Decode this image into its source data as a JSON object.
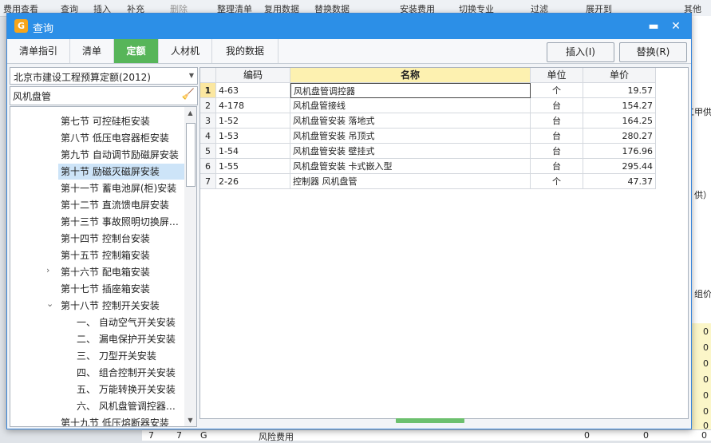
{
  "background": {
    "toolbar": [
      "费用查看",
      "查询",
      "插入",
      "补充",
      "删除",
      "整理清单",
      "复用数据",
      "替换数据",
      "安装费用",
      "切换专业",
      "过滤",
      "展开到",
      "其他"
    ],
    "right_labels": [
      "工甲供",
      "供）",
      "组价"
    ],
    "right_zeros": [
      "0",
      "0",
      "0",
      "0",
      "0",
      "0",
      "0"
    ],
    "bottom_row": {
      "a": "7",
      "b": "7",
      "c": "G",
      "name": "风险费用",
      "v1": "0",
      "v2": "0",
      "v3": "0"
    }
  },
  "dialog": {
    "title": "查询",
    "minimize_icon": "minimize-icon",
    "close_icon": "close-icon",
    "tabs": [
      "清单指引",
      "清单",
      "定额",
      "人材机",
      "我的数据"
    ],
    "active_tab": "定额",
    "insert_label": "插入(I)",
    "replace_label": "替换(R)"
  },
  "left": {
    "quota_library": "北京市建设工程预算定额(2012)",
    "search_value": "风机盘管",
    "tree": [
      {
        "label": "第七节 可控硅柜安装",
        "indent": 1,
        "arrow": ""
      },
      {
        "label": "第八节 低压电容器柜安装",
        "indent": 1,
        "arrow": ""
      },
      {
        "label": "第九节 自动调节励磁屏安装",
        "indent": 1,
        "arrow": ""
      },
      {
        "label": "第十节 励磁灭磁屏安装",
        "indent": 1,
        "arrow": "",
        "selected": true
      },
      {
        "label": "第十一节 蓄电池屏(柜)安装",
        "indent": 1,
        "arrow": ""
      },
      {
        "label": "第十二节 直流馈电屏安装",
        "indent": 1,
        "arrow": ""
      },
      {
        "label": "第十三节 事故照明切换屏…",
        "indent": 1,
        "arrow": ""
      },
      {
        "label": "第十四节 控制台安装",
        "indent": 1,
        "arrow": ""
      },
      {
        "label": "第十五节 控制箱安装",
        "indent": 1,
        "arrow": ""
      },
      {
        "label": "第十六节 配电箱安装",
        "indent": 1,
        "arrow": "›"
      },
      {
        "label": "第十七节 插座箱安装",
        "indent": 1,
        "arrow": ""
      },
      {
        "label": "第十八节 控制开关安装",
        "indent": 1,
        "arrow": "⌄"
      },
      {
        "label": "一、 自动空气开关安装",
        "indent": 2,
        "arrow": ""
      },
      {
        "label": "二、 漏电保护开关安装",
        "indent": 2,
        "arrow": ""
      },
      {
        "label": "三、 刀型开关安装",
        "indent": 2,
        "arrow": ""
      },
      {
        "label": "四、 组合控制开关安装",
        "indent": 2,
        "arrow": ""
      },
      {
        "label": "五、 万能转换开关安装",
        "indent": 2,
        "arrow": ""
      },
      {
        "label": "六、 风机盘管调控器…",
        "indent": 2,
        "arrow": ""
      },
      {
        "label": "第十九节 低压熔断器安装",
        "indent": 1,
        "arrow": ""
      }
    ]
  },
  "grid": {
    "headers": [
      "编码",
      "名称",
      "单位",
      "单价"
    ],
    "rows": [
      {
        "no": "1",
        "code": "4-63",
        "name": "风机盘管调控器",
        "unit": "个",
        "price": "19.57"
      },
      {
        "no": "2",
        "code": "4-178",
        "name": "风机盘管接线",
        "unit": "台",
        "price": "154.27"
      },
      {
        "no": "3",
        "code": "1-52",
        "name": "风机盘管安装 落地式",
        "unit": "台",
        "price": "164.25"
      },
      {
        "no": "4",
        "code": "1-53",
        "name": "风机盘管安装 吊顶式",
        "unit": "台",
        "price": "280.27"
      },
      {
        "no": "5",
        "code": "1-54",
        "name": "风机盘管安装 壁挂式",
        "unit": "台",
        "price": "176.96"
      },
      {
        "no": "6",
        "code": "1-55",
        "name": "风机盘管安装 卡式嵌入型",
        "unit": "台",
        "price": "295.44"
      },
      {
        "no": "7",
        "code": "2-26",
        "name": "控制器 风机盘管",
        "unit": "个",
        "price": "47.37"
      }
    ]
  },
  "colors": {
    "titlebar": "#2c8fe7",
    "active_tab": "#57b559",
    "header_highlight": "#fdf1b0"
  }
}
